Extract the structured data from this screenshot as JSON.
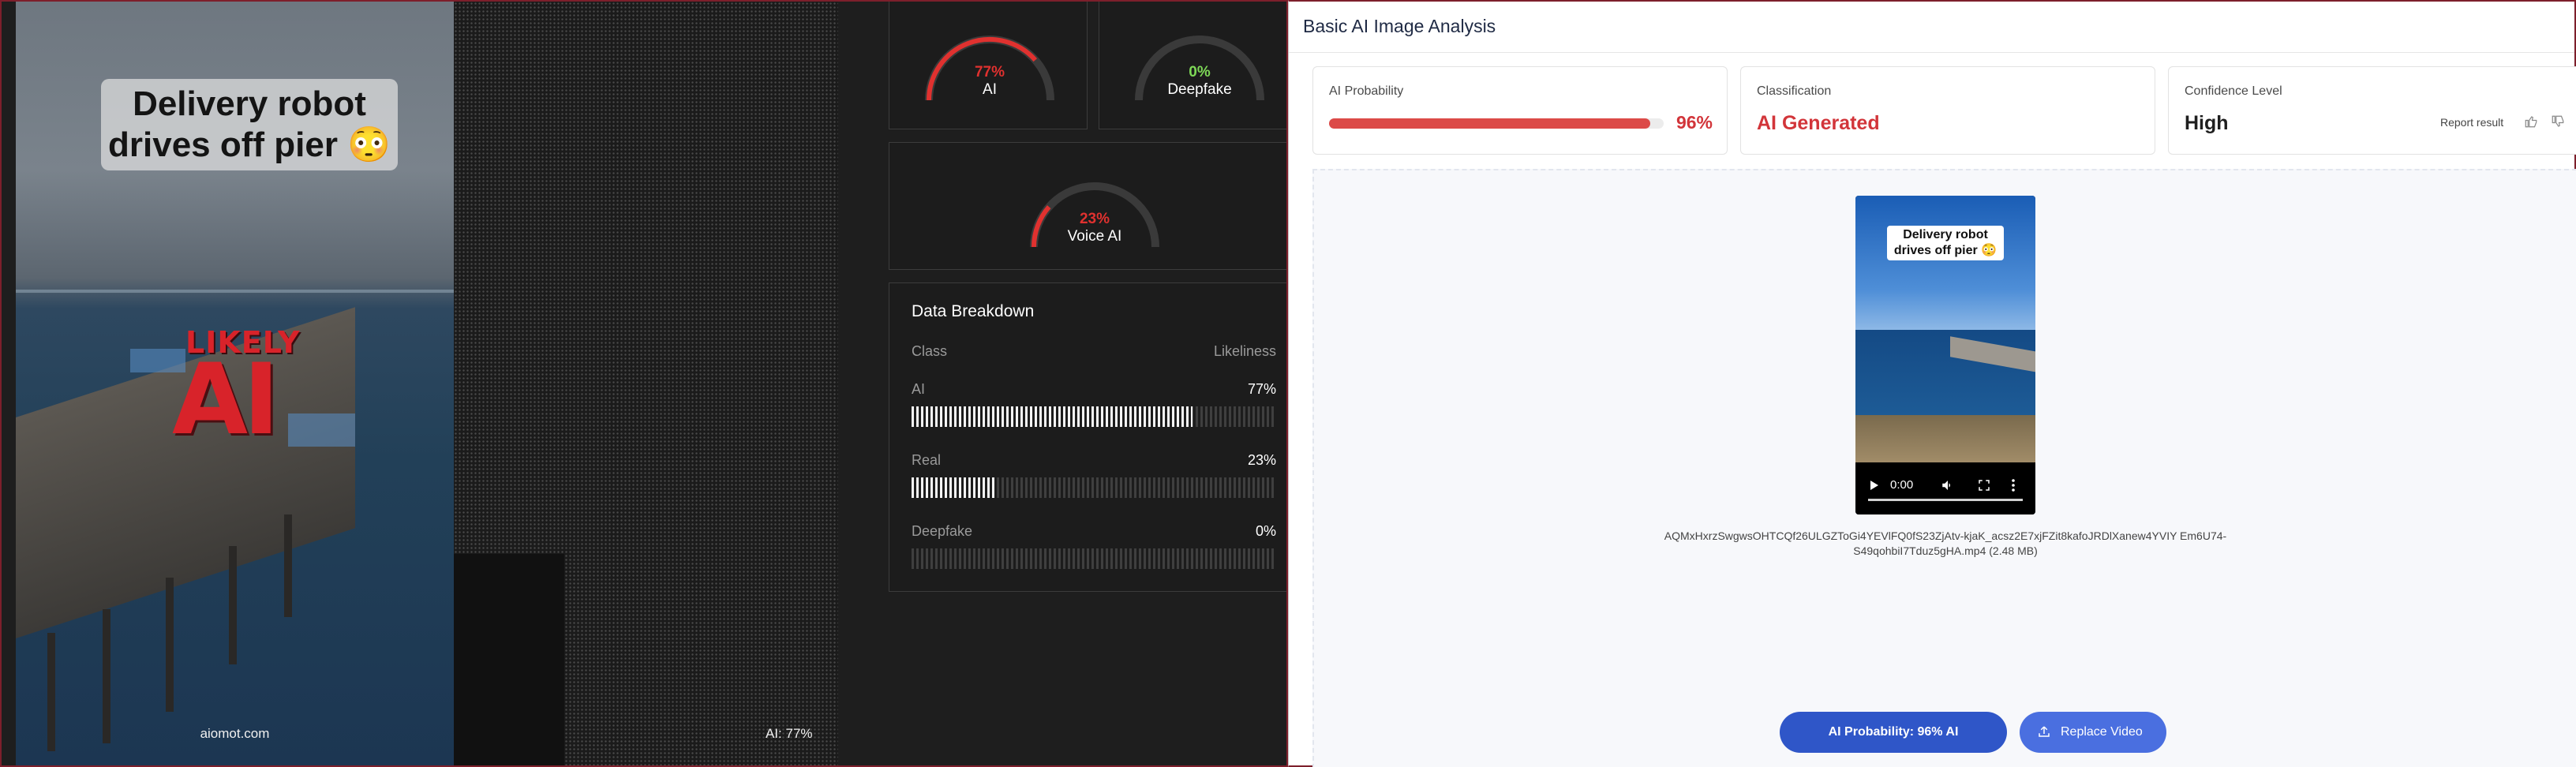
{
  "video_overlay": {
    "caption": "Delivery robot drives off pier 😳",
    "badge_top": "LIKELY",
    "badge_bottom": "AI",
    "watermark": "aiomot.com",
    "ai_label": "AI: 77%"
  },
  "gauges": [
    {
      "value": "77%",
      "label": "AI",
      "fraction": 0.77,
      "color": "#e0312f"
    },
    {
      "value": "0%",
      "label": "Deepfake",
      "fraction": 0.0,
      "color": "#7ed957"
    },
    {
      "value": "23%",
      "label": "Voice AI",
      "fraction": 0.23,
      "color": "#e0312f"
    }
  ],
  "breakdown": {
    "title": "Data Breakdown",
    "col_class": "Class",
    "col_likeliness": "Likeliness",
    "rows": [
      {
        "label": "AI",
        "value": "77%",
        "fraction": 0.77
      },
      {
        "label": "Real",
        "value": "23%",
        "fraction": 0.23
      },
      {
        "label": "Deepfake",
        "value": "0%",
        "fraction": 0.0
      }
    ]
  },
  "analysis": {
    "title": "Basic AI Image Analysis",
    "probability_label": "AI Probability",
    "probability_value": "96%",
    "probability_fraction": 0.96,
    "classification_label": "Classification",
    "classification_value": "AI Generated",
    "confidence_label": "Confidence Level",
    "confidence_value": "High",
    "report_label": "Report result",
    "accent_red": "#d2353a"
  },
  "preview": {
    "caption": "Delivery robot drives off pier 😳",
    "time": "0:00",
    "file_name": "AQMxHxrzSwgwsOHTCQf26ULGZToGi4YEVlFQ0fS23ZjAtv-kjaK_acsz2E7xjFZit8kafoJRDlXanew4YVIY Em6U74-S49qohbiI7Tduz5gHA.mp4 (2.48 MB)"
  },
  "buttons": {
    "probability": "AI Probability: 96% AI",
    "replace": "Replace Video"
  }
}
